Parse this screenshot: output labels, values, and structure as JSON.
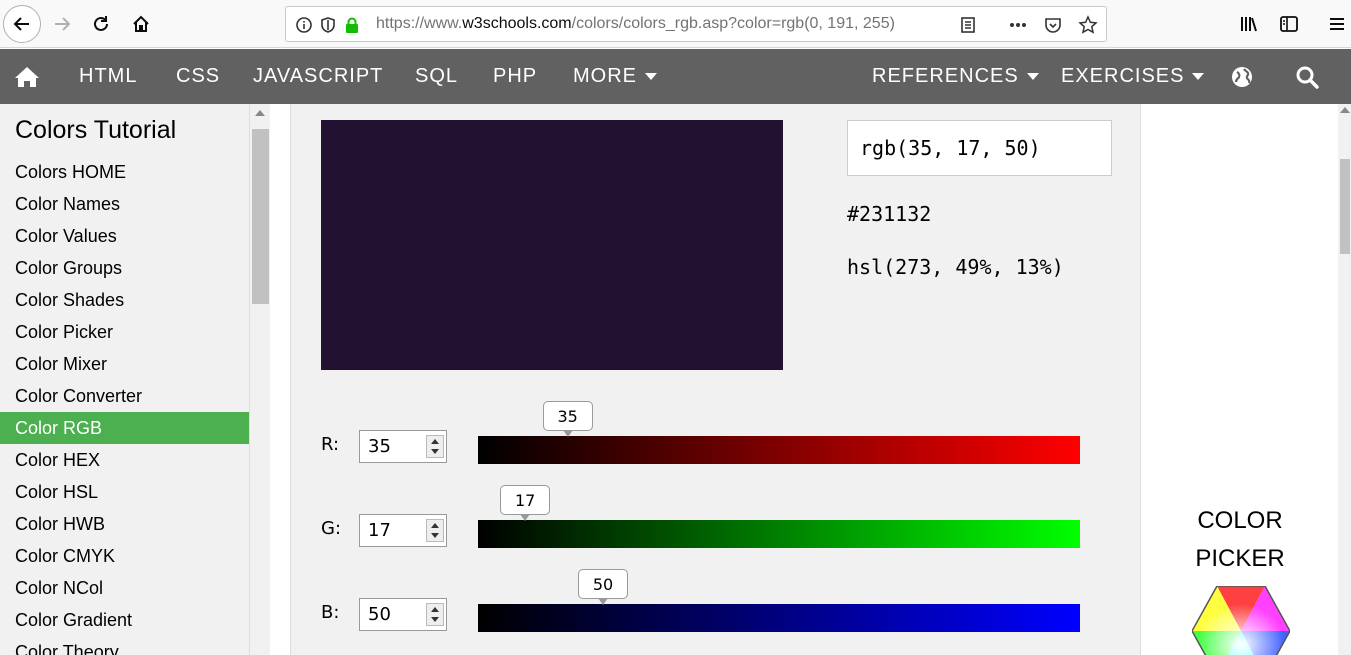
{
  "browser": {
    "url_prefix": "https://www.",
    "url_domain": "w3schools.com",
    "url_path": "/colors/colors_rgb.asp?color=rgb(0, 191, 255)"
  },
  "nav": {
    "items": [
      "HTML",
      "CSS",
      "JAVASCRIPT",
      "SQL",
      "PHP",
      "MORE",
      "REFERENCES",
      "EXERCISES"
    ],
    "bg_color": "#616161"
  },
  "sidebar": {
    "title": "Colors Tutorial",
    "items": [
      "Colors HOME",
      "Color Names",
      "Color Values",
      "Color Groups",
      "Color Shades",
      "Color Picker",
      "Color Mixer",
      "Color Converter",
      "Color RGB",
      "Color HEX",
      "Color HSL",
      "Color HWB",
      "Color CMYK",
      "Color NCol",
      "Color Gradient",
      "Color Theory"
    ],
    "active_index": 8,
    "active_color": "#4caf50"
  },
  "color": {
    "rgb_text": "rgb(35, 17, 50)",
    "hex_text": "#231132",
    "hsl_text": "hsl(273, 49%, 13%)",
    "swatch": "#231132"
  },
  "channels": [
    {
      "label": "R:",
      "value": "35",
      "num": 35,
      "end_color": "#ff0000"
    },
    {
      "label": "G:",
      "value": "17",
      "num": 17,
      "end_color": "#00ff00"
    },
    {
      "label": "B:",
      "value": "50",
      "num": 50,
      "end_color": "#0000ff"
    }
  ],
  "right": {
    "picker_line1": "COLOR",
    "picker_line2": "PICKER"
  }
}
